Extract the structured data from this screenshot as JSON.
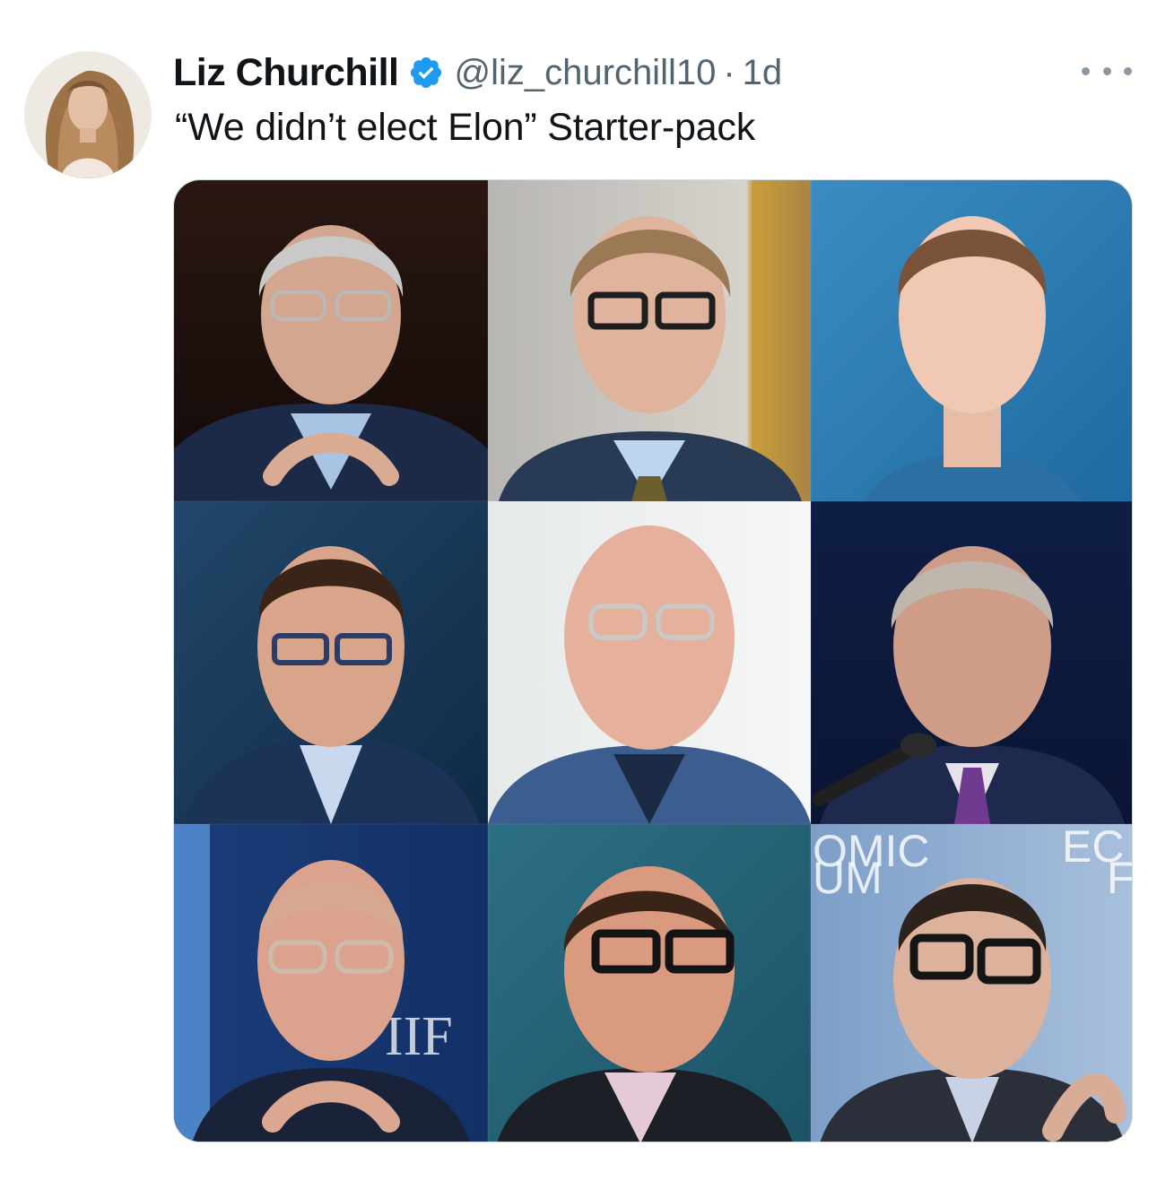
{
  "tweet": {
    "author_name": "Liz Churchill",
    "handle": "@liz_churchill10",
    "separator": "·",
    "time": "1d",
    "text": "“We didn’t elect Elon” Starter-pack"
  },
  "media": {
    "rows": 3,
    "columns": 3,
    "signage_text": [
      "IIF",
      "OMIC",
      "UM",
      "EC",
      "F"
    ]
  },
  "colors": {
    "verified_badge": "#1d9bf0",
    "secondary_text": "#536471",
    "primary_text": "#0f1419"
  },
  "icons": {
    "verified": "verified-badge-icon",
    "more": "more-dots-icon"
  }
}
